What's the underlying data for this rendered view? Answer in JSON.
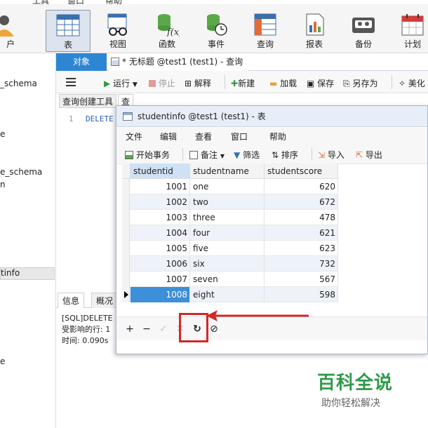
{
  "top_menu": [
    "工具",
    "窗口",
    "帮助"
  ],
  "toolbar": {
    "items": [
      {
        "label": "户",
        "icon": "user-icon"
      },
      {
        "label": "表",
        "icon": "table-icon"
      },
      {
        "label": "视图",
        "icon": "view-icon"
      },
      {
        "label": "函数",
        "icon": "function-icon"
      },
      {
        "label": "事件",
        "icon": "event-icon"
      },
      {
        "label": "查询",
        "icon": "query-icon"
      },
      {
        "label": "报表",
        "icon": "report-icon"
      },
      {
        "label": "备份",
        "icon": "backup-icon"
      },
      {
        "label": "计划",
        "icon": "schedule-icon"
      }
    ]
  },
  "sidebar": {
    "items": [
      "_schema",
      "e",
      "e_schema",
      "n",
      "tinfo",
      "e"
    ]
  },
  "tabs": {
    "objects": "对象",
    "query": "* 无标题 @test1 (test1) - 查询"
  },
  "query_toolbar": {
    "run": "运行",
    "stop": "停止",
    "explain": "解释",
    "new": "新建",
    "load": "加载",
    "save": "保存",
    "save_as": "另存为",
    "beautify": "美化"
  },
  "subtabs": {
    "builder": "查询创建工具",
    "editor": "查询编辑器"
  },
  "editor": {
    "line_no": "1",
    "code": "DELETE"
  },
  "info": {
    "tab_info": "信息",
    "tab_overview": "概况",
    "lines": [
      "[SQL]DELETE",
      "受影响的行: 1",
      "时间: 0.090s"
    ]
  },
  "table_window": {
    "title": "studentinfo @test1 (test1) - 表",
    "menu": [
      "文件",
      "编辑",
      "查看",
      "窗口",
      "帮助"
    ],
    "tools": {
      "begin_tx": "开始事务",
      "note": "备注",
      "filter": "筛选",
      "sort": "排序",
      "import": "导入",
      "export": "导出"
    },
    "columns": [
      "studentid",
      "studentname",
      "studentscore"
    ],
    "rows": [
      {
        "id": "1001",
        "name": "one",
        "score": "620"
      },
      {
        "id": "1002",
        "name": "two",
        "score": "672"
      },
      {
        "id": "1003",
        "name": "three",
        "score": "478"
      },
      {
        "id": "1004",
        "name": "four",
        "score": "621"
      },
      {
        "id": "1005",
        "name": "five",
        "score": "623"
      },
      {
        "id": "1006",
        "name": "six",
        "score": "732"
      },
      {
        "id": "1007",
        "name": "seven",
        "score": "567"
      },
      {
        "id": "1008",
        "name": "eight",
        "score": "598"
      }
    ],
    "nav": {
      "add": "+",
      "delete": "−",
      "apply": "✓",
      "cancel": "✕",
      "refresh": "↻",
      "stop": "⊘"
    }
  },
  "watermark": {
    "main": "百科全说",
    "sub": "助你轻松解决"
  },
  "colors": {
    "accent": "#2d86d3",
    "selected_cell": "#3c8fd8",
    "annotation": "#d42727",
    "watermark": "#2e9b49"
  }
}
